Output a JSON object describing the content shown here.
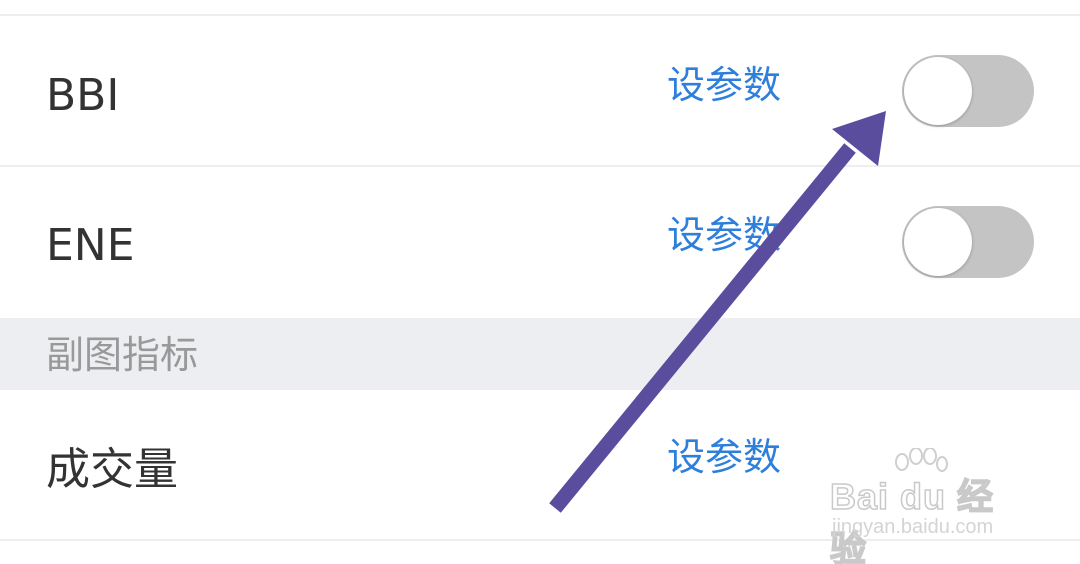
{
  "indicator_rows": [
    {
      "label": "BBI",
      "link_label": "设参数",
      "toggle_on": false
    },
    {
      "label": "ENE",
      "link_label": "设参数",
      "toggle_on": false
    }
  ],
  "sub_section": {
    "title": "副图指标",
    "rows": [
      {
        "label": "成交量",
        "link_label": "设参数"
      }
    ]
  },
  "annotation": {
    "arrow_color": "#5b4d9e",
    "target": "BBI toggle"
  },
  "colors": {
    "link": "#2e7fdc",
    "toggle_off": "#c4c4c4",
    "section_bg": "#eceef1"
  },
  "watermark": {
    "brand": "Bai du 经验",
    "url": "jingyan.baidu.com"
  }
}
